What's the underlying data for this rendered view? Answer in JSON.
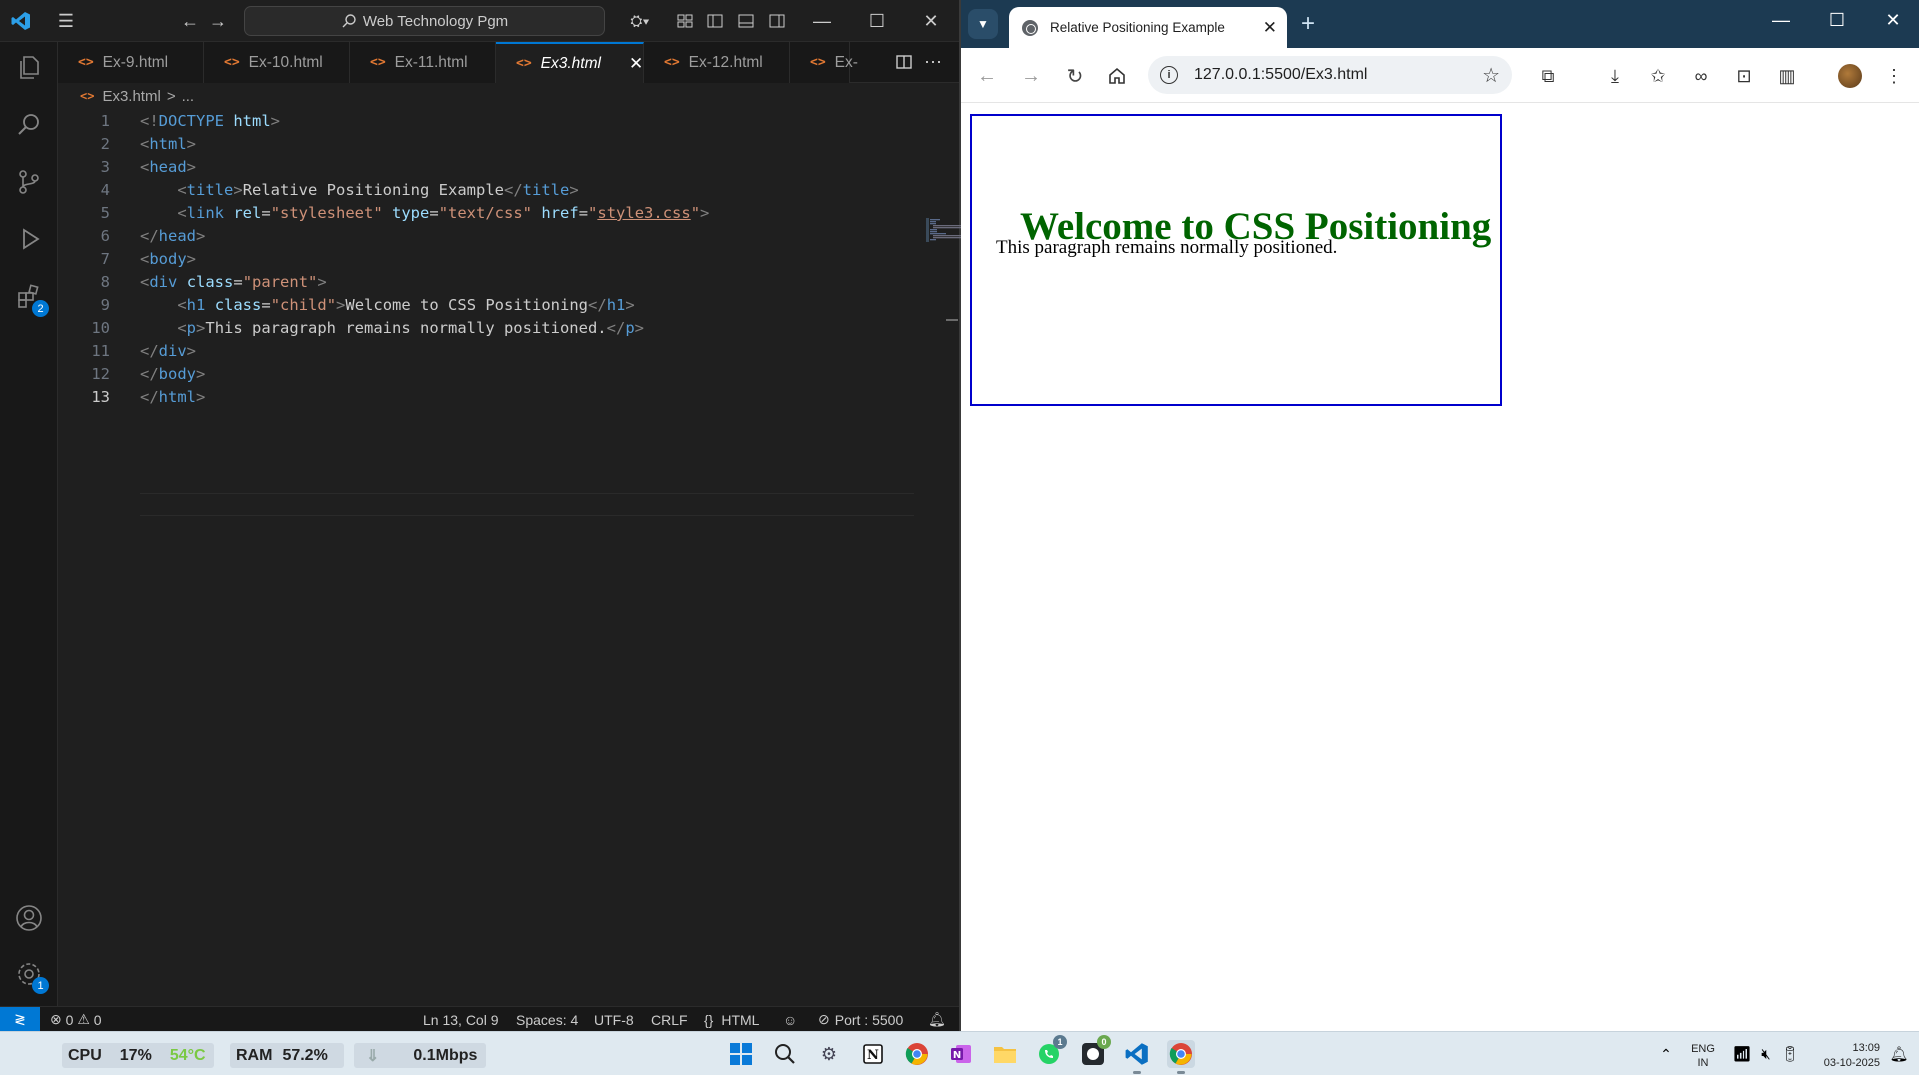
{
  "vscode": {
    "search_label": "Web Technology Pgm",
    "tabs": [
      {
        "label": "Ex-9.html"
      },
      {
        "label": "Ex-10.html"
      },
      {
        "label": "Ex-11.html"
      },
      {
        "label": "Ex3.html",
        "active": true
      },
      {
        "label": "Ex-12.html"
      },
      {
        "label": "Ex-"
      }
    ],
    "breadcrumb": {
      "file": "Ex3.html",
      "sep": ">",
      "more": "..."
    },
    "activity_badges": {
      "extensions": "2",
      "settings": "1"
    },
    "code_lines": [
      {
        "n": "1",
        "tokens": [
          [
            "br",
            "<!"
          ],
          [
            "tag",
            "DOCTYPE"
          ],
          [
            "txt",
            " "
          ],
          [
            "attr",
            "html"
          ],
          [
            "br",
            ">"
          ]
        ]
      },
      {
        "n": "2",
        "tokens": [
          [
            "br",
            "<"
          ],
          [
            "tag",
            "html"
          ],
          [
            "br",
            ">"
          ]
        ]
      },
      {
        "n": "3",
        "tokens": [
          [
            "br",
            "<"
          ],
          [
            "tag",
            "head"
          ],
          [
            "br",
            ">"
          ]
        ]
      },
      {
        "n": "4",
        "tokens": [
          [
            "txt",
            "    "
          ],
          [
            "br",
            "<"
          ],
          [
            "tag",
            "title"
          ],
          [
            "br",
            ">"
          ],
          [
            "txt",
            "Relative Positioning Example"
          ],
          [
            "br",
            "</"
          ],
          [
            "tag",
            "title"
          ],
          [
            "br",
            ">"
          ]
        ]
      },
      {
        "n": "5",
        "tokens": [
          [
            "txt",
            "    "
          ],
          [
            "br",
            "<"
          ],
          [
            "tag",
            "link"
          ],
          [
            "txt",
            " "
          ],
          [
            "attr",
            "rel"
          ],
          [
            "txt",
            "="
          ],
          [
            "str",
            "\"stylesheet\""
          ],
          [
            "txt",
            " "
          ],
          [
            "attr",
            "type"
          ],
          [
            "txt",
            "="
          ],
          [
            "str",
            "\"text/css\""
          ],
          [
            "txt",
            " "
          ],
          [
            "attr",
            "href"
          ],
          [
            "txt",
            "="
          ],
          [
            "str",
            "\""
          ],
          [
            "link",
            "style3.css"
          ],
          [
            "str",
            "\""
          ],
          [
            "br",
            ">"
          ]
        ]
      },
      {
        "n": "6",
        "tokens": [
          [
            "br",
            "</"
          ],
          [
            "tag",
            "head"
          ],
          [
            "br",
            ">"
          ]
        ]
      },
      {
        "n": "7",
        "tokens": [
          [
            "br",
            "<"
          ],
          [
            "tag",
            "body"
          ],
          [
            "br",
            ">"
          ]
        ]
      },
      {
        "n": "8",
        "tokens": [
          [
            "br",
            "<"
          ],
          [
            "tag",
            "div"
          ],
          [
            "txt",
            " "
          ],
          [
            "attr",
            "class"
          ],
          [
            "txt",
            "="
          ],
          [
            "str",
            "\"parent\""
          ],
          [
            "br",
            ">"
          ]
        ]
      },
      {
        "n": "9",
        "tokens": [
          [
            "txt",
            "    "
          ],
          [
            "br",
            "<"
          ],
          [
            "tag",
            "h1"
          ],
          [
            "txt",
            " "
          ],
          [
            "attr",
            "class"
          ],
          [
            "txt",
            "="
          ],
          [
            "str",
            "\"child\""
          ],
          [
            "br",
            ">"
          ],
          [
            "txt",
            "Welcome to CSS Positioning"
          ],
          [
            "br",
            "</"
          ],
          [
            "tag",
            "h1"
          ],
          [
            "br",
            ">"
          ]
        ]
      },
      {
        "n": "10",
        "tokens": [
          [
            "txt",
            "    "
          ],
          [
            "br",
            "<"
          ],
          [
            "tag",
            "p"
          ],
          [
            "br",
            ">"
          ],
          [
            "txt",
            "This paragraph remains normally positioned."
          ],
          [
            "br",
            "</"
          ],
          [
            "tag",
            "p"
          ],
          [
            "br",
            ">"
          ]
        ]
      },
      {
        "n": "11",
        "tokens": [
          [
            "br",
            "</"
          ],
          [
            "tag",
            "div"
          ],
          [
            "br",
            ">"
          ]
        ]
      },
      {
        "n": "12",
        "tokens": [
          [
            "br",
            "</"
          ],
          [
            "tag",
            "body"
          ],
          [
            "br",
            ">"
          ]
        ]
      },
      {
        "n": "13",
        "tokens": [
          [
            "br",
            "</"
          ],
          [
            "tag",
            "html"
          ],
          [
            "br",
            ">"
          ]
        ]
      }
    ],
    "current_line": "13",
    "status": {
      "errors": "0",
      "warnings": "0",
      "position": "Ln 13, Col 9",
      "spaces": "Spaces: 4",
      "encoding": "UTF-8",
      "eol": "CRLF",
      "language": "HTML",
      "port": "Port : 5500"
    }
  },
  "chrome": {
    "tab_title": "Relative Positioning Example",
    "url": "127.0.0.1:5500/Ex3.html",
    "page": {
      "heading": "Welcome to CSS Positioning",
      "paragraph": "This paragraph remains normally positioned.",
      "border_color": "#0000cc",
      "heading_color": "#006400"
    }
  },
  "taskbar": {
    "cpu_label": "CPU",
    "cpu_value": "17%",
    "cpu_temp": "54°C",
    "ram_label": "RAM",
    "ram_value": "57.2%",
    "net_value": "0.1Mbps",
    "lang_top": "ENG",
    "lang_bottom": "IN",
    "time": "13:09",
    "date": "03-10-2025",
    "badges": {
      "whatsapp": "1",
      "github": "0"
    }
  },
  "colors": {
    "vscode_bg": "#1f1f1f",
    "accent": "#0078d4",
    "chrome_tabbar": "#1c3a52",
    "taskbar_bg": "#dfe9f0"
  }
}
